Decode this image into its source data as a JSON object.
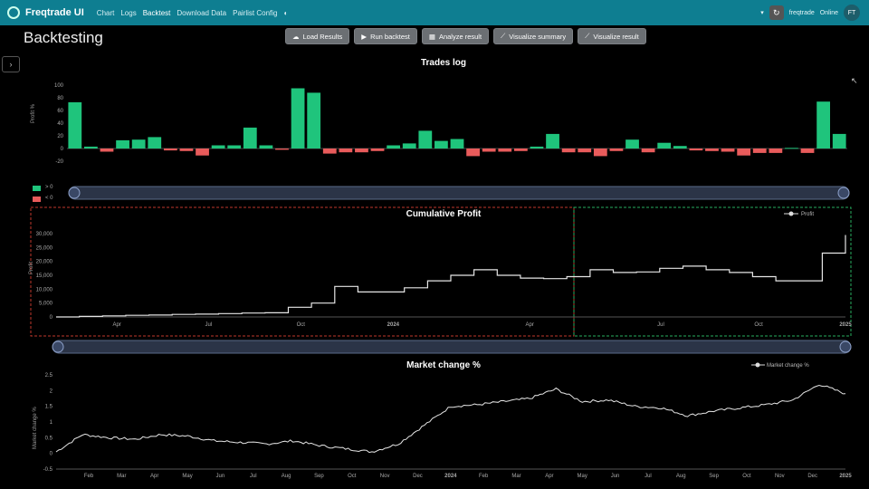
{
  "navbar": {
    "brand": "Freqtrade UI",
    "links": [
      "Chart",
      "Logs",
      "Backtest",
      "Download Data",
      "Pairlist Config"
    ],
    "bot_name": "freqtrade",
    "status": "Online",
    "avatar": "FT"
  },
  "page": {
    "title": "Backtesting"
  },
  "toolbar": {
    "buttons": [
      "Load Results",
      "Run backtest",
      "Analyze result",
      "Visualize summary",
      "Visualize result"
    ]
  },
  "side_toggle_glyph": "›",
  "colors": {
    "accent": "#0e7e91",
    "profit": "#1fc47c",
    "loss": "#e85b5b",
    "line": "#e6e6e6"
  },
  "trades_chart": {
    "title": "Trades log",
    "ylabel": "Profit %",
    "yticks": [
      "100",
      "80",
      "60",
      "40",
      "20",
      "0",
      "-20"
    ],
    "legend": [
      {
        "label": "> 0",
        "color": "#1fc47c"
      },
      {
        "label": "< 0",
        "color": "#e85b5b"
      }
    ]
  },
  "cumulative_chart": {
    "title": "Cumulative Profit",
    "ylabel": "Profit",
    "legend": "Profit",
    "yticks": [
      "30,000",
      "25,000",
      "20,000",
      "15,000",
      "10,000",
      "5,000",
      "0"
    ],
    "xticks": [
      "Apr",
      "Jul",
      "Oct",
      "2024",
      "Apr",
      "Jul",
      "Oct",
      "2025"
    ]
  },
  "market_chart": {
    "title": "Market change %",
    "ylabel": "Market change %",
    "legend": "Market change %",
    "yticks": [
      "2.5",
      "2",
      "1.5",
      "1",
      "0.5",
      "0",
      "-0.5"
    ],
    "xticks": [
      "Feb",
      "Mar",
      "Apr",
      "May",
      "Jun",
      "Jul",
      "Aug",
      "Sep",
      "Oct",
      "Nov",
      "Dec",
      "2024",
      "Feb",
      "Mar",
      "Apr",
      "May",
      "Jun",
      "Jul",
      "Aug",
      "Sep",
      "Oct",
      "Nov",
      "Dec",
      "2025"
    ]
  },
  "chart_data": [
    {
      "type": "bar",
      "title": "Trades log",
      "ylabel": "Profit %",
      "ylim": [
        -20,
        100
      ],
      "values": [
        73,
        3,
        -5,
        13,
        14,
        18,
        -3,
        -4,
        -11,
        5,
        5,
        33,
        5,
        -2,
        95,
        88,
        -8,
        -6,
        -6,
        -4,
        5,
        8,
        28,
        12,
        15,
        -12,
        -5,
        -5,
        -4,
        3,
        23,
        -6,
        -6,
        -12,
        -4,
        14,
        -6,
        9,
        4,
        -3,
        -4,
        -5,
        -11,
        -7,
        -7,
        1,
        -7,
        74,
        23
      ]
    },
    {
      "type": "line",
      "title": "Cumulative Profit",
      "ylabel": "Profit",
      "ylim": [
        0,
        30000
      ],
      "x_range": [
        "2023-01",
        "2025-01"
      ],
      "values": [
        0,
        200,
        400,
        600,
        700,
        900,
        1000,
        1200,
        1400,
        1500,
        3500,
        5000,
        11000,
        9000,
        9000,
        10500,
        13000,
        15000,
        17000,
        15000,
        14000,
        13800,
        14500,
        17000,
        16000,
        16200,
        17500,
        18300,
        17000,
        16000,
        14500,
        13000,
        13000,
        23000,
        29500
      ]
    },
    {
      "type": "line",
      "title": "Market change %",
      "ylabel": "Market change %",
      "ylim": [
        -0.5,
        2.5
      ],
      "x_range": [
        "2023-01",
        "2025-01"
      ],
      "values": [
        0.05,
        0.6,
        0.5,
        0.45,
        0.6,
        0.55,
        0.4,
        0.35,
        0.3,
        0.4,
        0.25,
        0.15,
        0.05,
        0.3,
        0.9,
        1.5,
        1.55,
        1.65,
        1.75,
        2.05,
        1.65,
        1.7,
        1.5,
        1.45,
        1.2,
        1.35,
        1.45,
        1.55,
        1.7,
        2.2,
        1.9
      ]
    }
  ]
}
